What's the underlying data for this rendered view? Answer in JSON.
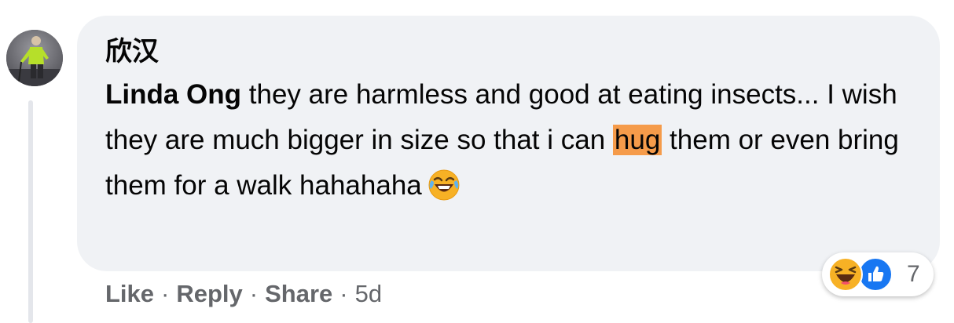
{
  "comment": {
    "author": "欣汉",
    "mention": "Linda Ong",
    "text_before_highlight": " they are harmless and good at eating insects... I wish they are much bigger in size so that i can ",
    "highlight": "hug",
    "text_after_highlight": " them or even bring them for a walk hahahaha",
    "inline_emoji": "tears-of-joy-emoji"
  },
  "reactions": {
    "icons": [
      "haha-reaction-icon",
      "like-reaction-icon"
    ],
    "count": "7",
    "haha_color": "#f7b125",
    "like_color": "#1877f2"
  },
  "actions": {
    "like": "Like",
    "reply": "Reply",
    "share": "Share",
    "separator": "·",
    "time": "5d"
  },
  "colors": {
    "bubble": "#f0f2f5",
    "highlight": "#f59b4a",
    "secondary_text": "#65676b",
    "thread_line": "#e4e6eb"
  }
}
